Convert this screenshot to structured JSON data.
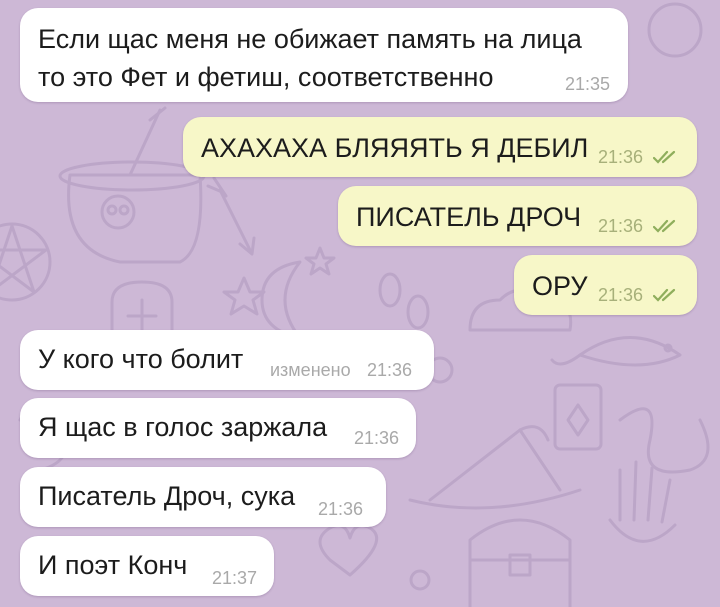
{
  "theme": {
    "chat_background": "#cdb8d6",
    "pattern_color": "#bca6c8",
    "incoming_bubble": "#ffffff",
    "outgoing_bubble": "#f7f7c8",
    "incoming_time_color": "#a9a9a9",
    "outgoing_time_color": "#a7b07a",
    "read_checks_color": "#8fae5c"
  },
  "messages": [
    {
      "direction": "incoming",
      "lines": [
        "Если щас меня не обижает память на лица",
        "то это Фет и фетиш, соответственно"
      ],
      "time": "21:35"
    },
    {
      "direction": "outgoing",
      "text": "АХАХАХА БЛЯЯЯТЬ Я ДЕБИЛ",
      "time": "21:36",
      "status_icon": "double-check-read-icon"
    },
    {
      "direction": "outgoing",
      "text": "ПИСАТЕЛЬ ДРОЧ",
      "time": "21:36",
      "status_icon": "double-check-read-icon"
    },
    {
      "direction": "outgoing",
      "text": "ОРУ",
      "time": "21:36",
      "status_icon": "double-check-read-icon"
    },
    {
      "direction": "incoming",
      "text": "У кого что болит",
      "edited_label": "изменено",
      "time": "21:36"
    },
    {
      "direction": "incoming",
      "text": "Я щас в голос заржала",
      "time": "21:36"
    },
    {
      "direction": "incoming",
      "text": "Писатель Дроч, сука",
      "time": "21:36"
    },
    {
      "direction": "incoming",
      "text": "И поэт Конч",
      "time": "21:37"
    }
  ]
}
